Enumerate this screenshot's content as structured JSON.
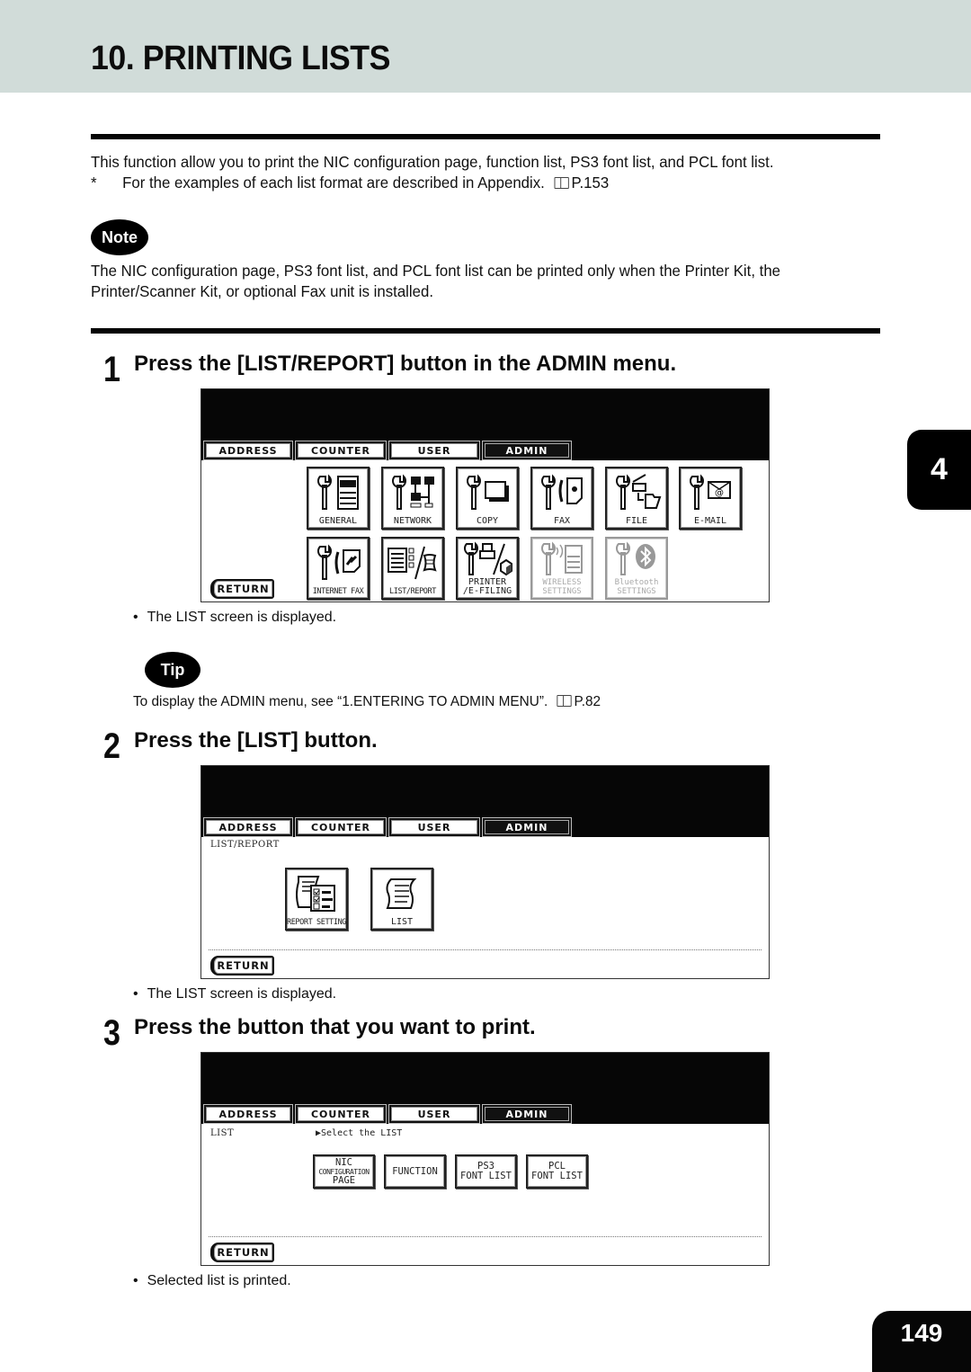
{
  "header": {
    "title": "10. PRINTING LISTS"
  },
  "intro": {
    "line1": "This function allow you to print the NIC configuration page, function list, PS3 font list, and PCL font list.",
    "line2_marker": "*",
    "line2": "For the examples of each list format are described in Appendix.",
    "line2_ref": "P.153"
  },
  "note": {
    "badge": "Note",
    "line1": "The NIC configuration page, PS3 font list, and PCL font list can be printed only when the Printer Kit, the",
    "line2": "Printer/Scanner Kit, or optional Fax unit is installed."
  },
  "steps": [
    {
      "number": "1",
      "title": "Press the [LIST/REPORT] button in the ADMIN menu.",
      "result": "The LIST screen is displayed."
    },
    {
      "number": "2",
      "title": "Press the [LIST] button.",
      "result": "The LIST screen is displayed."
    },
    {
      "number": "3",
      "title": "Press the button that you want to print.",
      "result": "Selected list is printed."
    }
  ],
  "tip": {
    "badge": "Tip",
    "text": "To display the ADMIN menu, see “1.ENTERING TO ADMIN MENU”.",
    "ref": "P.82"
  },
  "screen_tabs": [
    "ADDRESS",
    "COUNTER",
    "USER",
    "ADMIN"
  ],
  "screen_active_tab": "ADMIN",
  "screen1": {
    "buttons": [
      {
        "label": "GENERAL",
        "icon": "wrench-copier-icon",
        "enabled": true
      },
      {
        "label": "NETWORK",
        "icon": "wrench-network-icon",
        "enabled": true
      },
      {
        "label": "COPY",
        "icon": "wrench-copy-icon",
        "enabled": true
      },
      {
        "label": "FAX",
        "icon": "wrench-fax-icon",
        "enabled": true
      },
      {
        "label": "FILE",
        "icon": "wrench-file-icon",
        "enabled": true
      },
      {
        "label": "E-MAIL",
        "icon": "wrench-email-icon",
        "enabled": true
      },
      {
        "label": "INTERNET FAX",
        "icon": "wrench-internet-fax-icon",
        "enabled": true
      },
      {
        "label": "LIST/REPORT",
        "icon": "list-report-icon",
        "enabled": true
      },
      {
        "label": "PRINTER\n/E-FILING",
        "icon": "wrench-printer-efiling-icon",
        "enabled": true
      },
      {
        "label": "WIRELESS\nSETTINGS",
        "icon": "wrench-wireless-icon",
        "enabled": false
      },
      {
        "label": "Bluetooth\nSETTINGS",
        "icon": "wrench-bluetooth-icon",
        "enabled": false
      }
    ],
    "return_label": "RETURN"
  },
  "screen2": {
    "breadcrumb": "LIST/REPORT",
    "buttons": [
      {
        "label": "REPORT SETTING",
        "icon": "report-setting-icon"
      },
      {
        "label": "LIST",
        "icon": "list-icon"
      }
    ],
    "return_label": "RETURN"
  },
  "screen3": {
    "breadcrumb": "LIST",
    "prompt": "▶Select the LIST",
    "buttons": [
      {
        "line1": "NIC",
        "line2": "CONFIGURATION",
        "line3": "PAGE"
      },
      {
        "line1": "FUNCTION"
      },
      {
        "line1": "PS3",
        "line2": "FONT LIST"
      },
      {
        "line1": "PCL",
        "line2": "FONT LIST"
      }
    ],
    "return_label": "RETURN"
  },
  "chapter_tab": "4",
  "page_number": "149"
}
